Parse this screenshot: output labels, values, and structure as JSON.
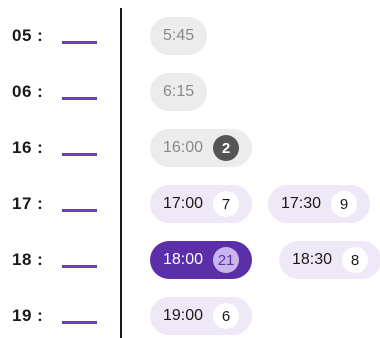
{
  "colors": {
    "accent": "#5b2fa8",
    "underline": "#6a3fc0",
    "available_bg": "#efe8f7",
    "disabled_bg": "#ececec",
    "selected_count_bg": "#c9b6ec"
  },
  "rows": [
    {
      "hour": "05 :",
      "slots": [
        {
          "time": "5:45",
          "state": "disabled"
        }
      ]
    },
    {
      "hour": "06 :",
      "slots": [
        {
          "time": "6:15",
          "state": "disabled"
        }
      ]
    },
    {
      "hour": "16 :",
      "slots": [
        {
          "time": "16:00",
          "count": "2",
          "state": "disabled"
        }
      ]
    },
    {
      "hour": "17 :",
      "slots": [
        {
          "time": "17:00",
          "count": "7",
          "state": "available"
        },
        {
          "time": "17:30",
          "count": "9",
          "state": "available"
        }
      ]
    },
    {
      "hour": "18 :",
      "slots": [
        {
          "time": "18:00",
          "count": "21",
          "state": "selected"
        },
        {
          "time": "18:30",
          "count": "8",
          "state": "available"
        }
      ]
    },
    {
      "hour": "19 :",
      "slots": [
        {
          "time": "19:00",
          "count": "6",
          "state": "available"
        }
      ]
    }
  ]
}
